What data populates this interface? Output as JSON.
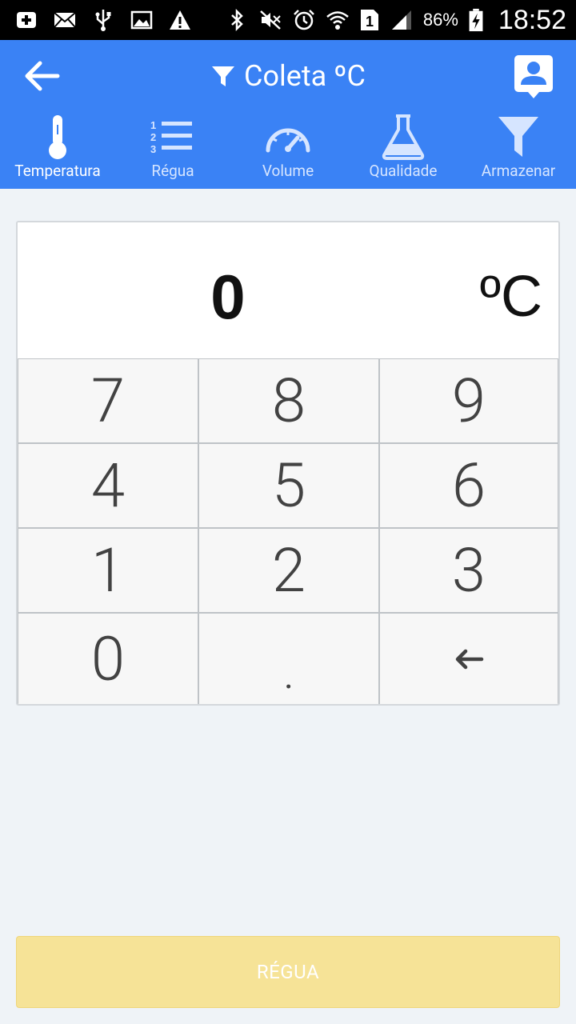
{
  "status_bar": {
    "battery_percent": "86%",
    "time": "18:52",
    "sim_slot": "1"
  },
  "app_bar": {
    "title": "Coleta ºC",
    "colors": {
      "primary": "#3a82f5",
      "button": "#f6e397"
    }
  },
  "tabs": [
    {
      "label": "Temperatura",
      "icon": "thermometer-icon",
      "active": true
    },
    {
      "label": "Régua",
      "icon": "numbered-list-icon",
      "active": false
    },
    {
      "label": "Volume",
      "icon": "gauge-icon",
      "active": false
    },
    {
      "label": "Qualidade",
      "icon": "flask-icon",
      "active": false
    },
    {
      "label": "Armazenar",
      "icon": "filter-icon",
      "active": false
    }
  ],
  "display": {
    "value": "0",
    "unit": "ºC"
  },
  "keypad": {
    "keys": [
      "7",
      "8",
      "9",
      "4",
      "5",
      "6",
      "1",
      "2",
      "3",
      "0",
      ".",
      "←"
    ]
  },
  "bottom_button": {
    "label": "RÉGUA"
  }
}
